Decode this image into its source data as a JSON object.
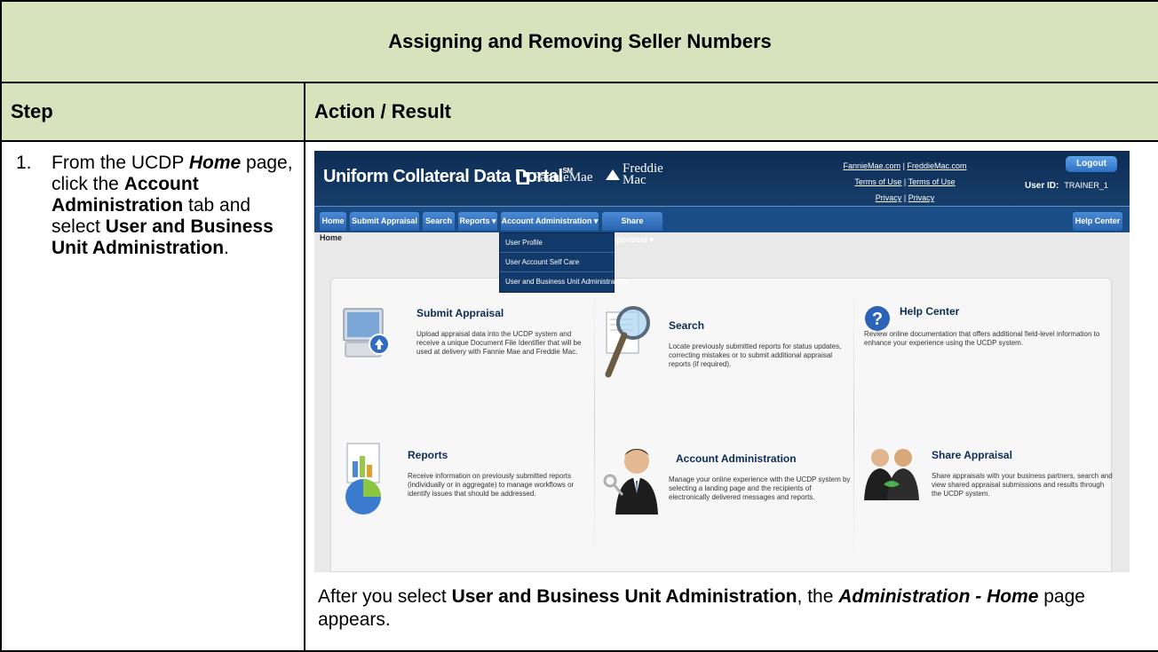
{
  "doc": {
    "title": "Assigning and Removing Seller Numbers",
    "col_step": "Step",
    "col_action": "Action / Result",
    "step_number": "1.",
    "step_p1": "From the UCDP ",
    "step_home": "Home",
    "step_p2": " page, click the ",
    "step_account_admin": "Account Administration",
    "step_p3": " tab and select ",
    "step_user_bu": "User and Business Unit Administration",
    "step_p4": ".",
    "result_p1": "After you select ",
    "result_user_bu": "User and Business Unit Administration",
    "result_p2": ", the ",
    "result_page": "Administration - Home",
    "result_p3": " page appears."
  },
  "screenshot": {
    "portal_title": "Uniform Collateral Data Portal",
    "portal_sm": "SM",
    "fannie_logo": "FannieMae",
    "freddie_logo_1": "Freddie",
    "freddie_logo_2": "Mac",
    "link_fannie": "FannieMae.com",
    "link_freddie": "FreddieMac.com",
    "link_sep": "|",
    "link_terms1": "Terms of Use",
    "link_terms2": "Terms of Use",
    "link_privacy1": "Privacy",
    "link_privacy2": "Privacy",
    "logout": "Logout",
    "user_id_label": "User ID:",
    "user_id_value": "TRAINER_1",
    "nav": {
      "home": "Home",
      "submit": "Submit Appraisal",
      "search": "Search",
      "reports": "Reports ▾",
      "account": "Account Administration ▾",
      "share": "Share Appraisal ▾",
      "help": "Help Center"
    },
    "breadcrumb": "Home",
    "dropdown": [
      "User Profile",
      "User Account Self Care",
      "User and Business Unit Administration"
    ],
    "cards": [
      {
        "title": "Submit Appraisal",
        "desc": "Upload appraisal data into the UCDP system and receive a unique Document File Identifier that will be used at delivery with Fannie Mae and Freddie Mac."
      },
      {
        "title": "Search",
        "desc": "Locate previously submitted reports for status updates, correcting mistakes or to submit additional appraisal reports (if required)."
      },
      {
        "title": "Help Center",
        "desc": "Review online documentation that offers additional field-level information to enhance your experience using the UCDP system."
      },
      {
        "title": "Reports",
        "desc": "Receive information on previously submitted reports (individually or in aggregate) to manage workflows or identify issues that should be addressed."
      },
      {
        "title": "Account Administration",
        "desc": "Manage your online experience with the UCDP system by selecting a landing page and the recipients of electronically delivered messages and reports."
      },
      {
        "title": "Share Appraisal",
        "desc": "Share appraisals with your business partners, search and view shared appraisal submissions and results through the UCDP system."
      }
    ],
    "colors": {
      "header": "#0d2c54",
      "nav": "#1a4c86",
      "tab": "#2a63ad",
      "doc_header": "#d6e3bc"
    }
  }
}
